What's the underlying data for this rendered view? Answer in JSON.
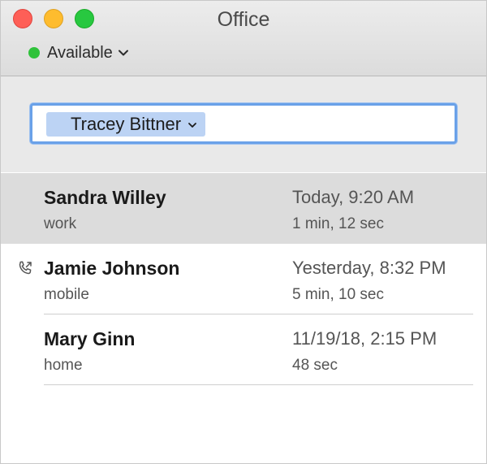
{
  "window": {
    "title": "Office"
  },
  "status": {
    "label": "Available",
    "color": "#2fc23a",
    "dropdown_icon": "chevron-down-icon"
  },
  "search": {
    "token_label": "Tracey Bittner",
    "token_icon": "chevron-down-icon",
    "value": ""
  },
  "calls": [
    {
      "name": "Sandra Willey",
      "type": "work",
      "time": "Today, 9:20 AM",
      "duration": "1 min, 12 sec",
      "selected": true,
      "icon": ""
    },
    {
      "name": "Jamie Johnson",
      "type": "mobile",
      "time": "Yesterday, 8:32 PM",
      "duration": "5 min, 10 sec",
      "selected": false,
      "icon": "outgoing-call-icon"
    },
    {
      "name": "Mary Ginn",
      "type": "home",
      "time": "11/19/18, 2:15 PM",
      "duration": "48 sec",
      "selected": false,
      "icon": ""
    }
  ],
  "colors": {
    "accent": "#6aa1e8",
    "token_bg": "#bcd3f4",
    "selected_row": "#dcdcdc"
  }
}
